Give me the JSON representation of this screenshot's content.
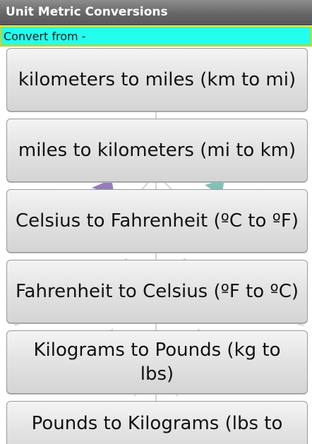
{
  "app": {
    "title": "Unit Metric Conversions"
  },
  "header": {
    "convert_from_label": "Convert from -"
  },
  "conversions": [
    {
      "label": "kilometers to miles (km to mi)"
    },
    {
      "label": "miles to kilometers (mi to km)"
    },
    {
      "label": "Celsius to Fahrenheit (ºC to ºF)"
    },
    {
      "label": "Fahrenheit to Celsius (ºF to ºC)"
    },
    {
      "label": "Kilograms to Pounds (kg to lbs)"
    },
    {
      "label": "Pounds to Kilograms (lbs to"
    }
  ],
  "colors": {
    "title_bar": "#6e6e6e",
    "subheader_bg": "#22ffee",
    "subheader_border": "#d8d200",
    "button_bg": "#e2e2e2"
  }
}
